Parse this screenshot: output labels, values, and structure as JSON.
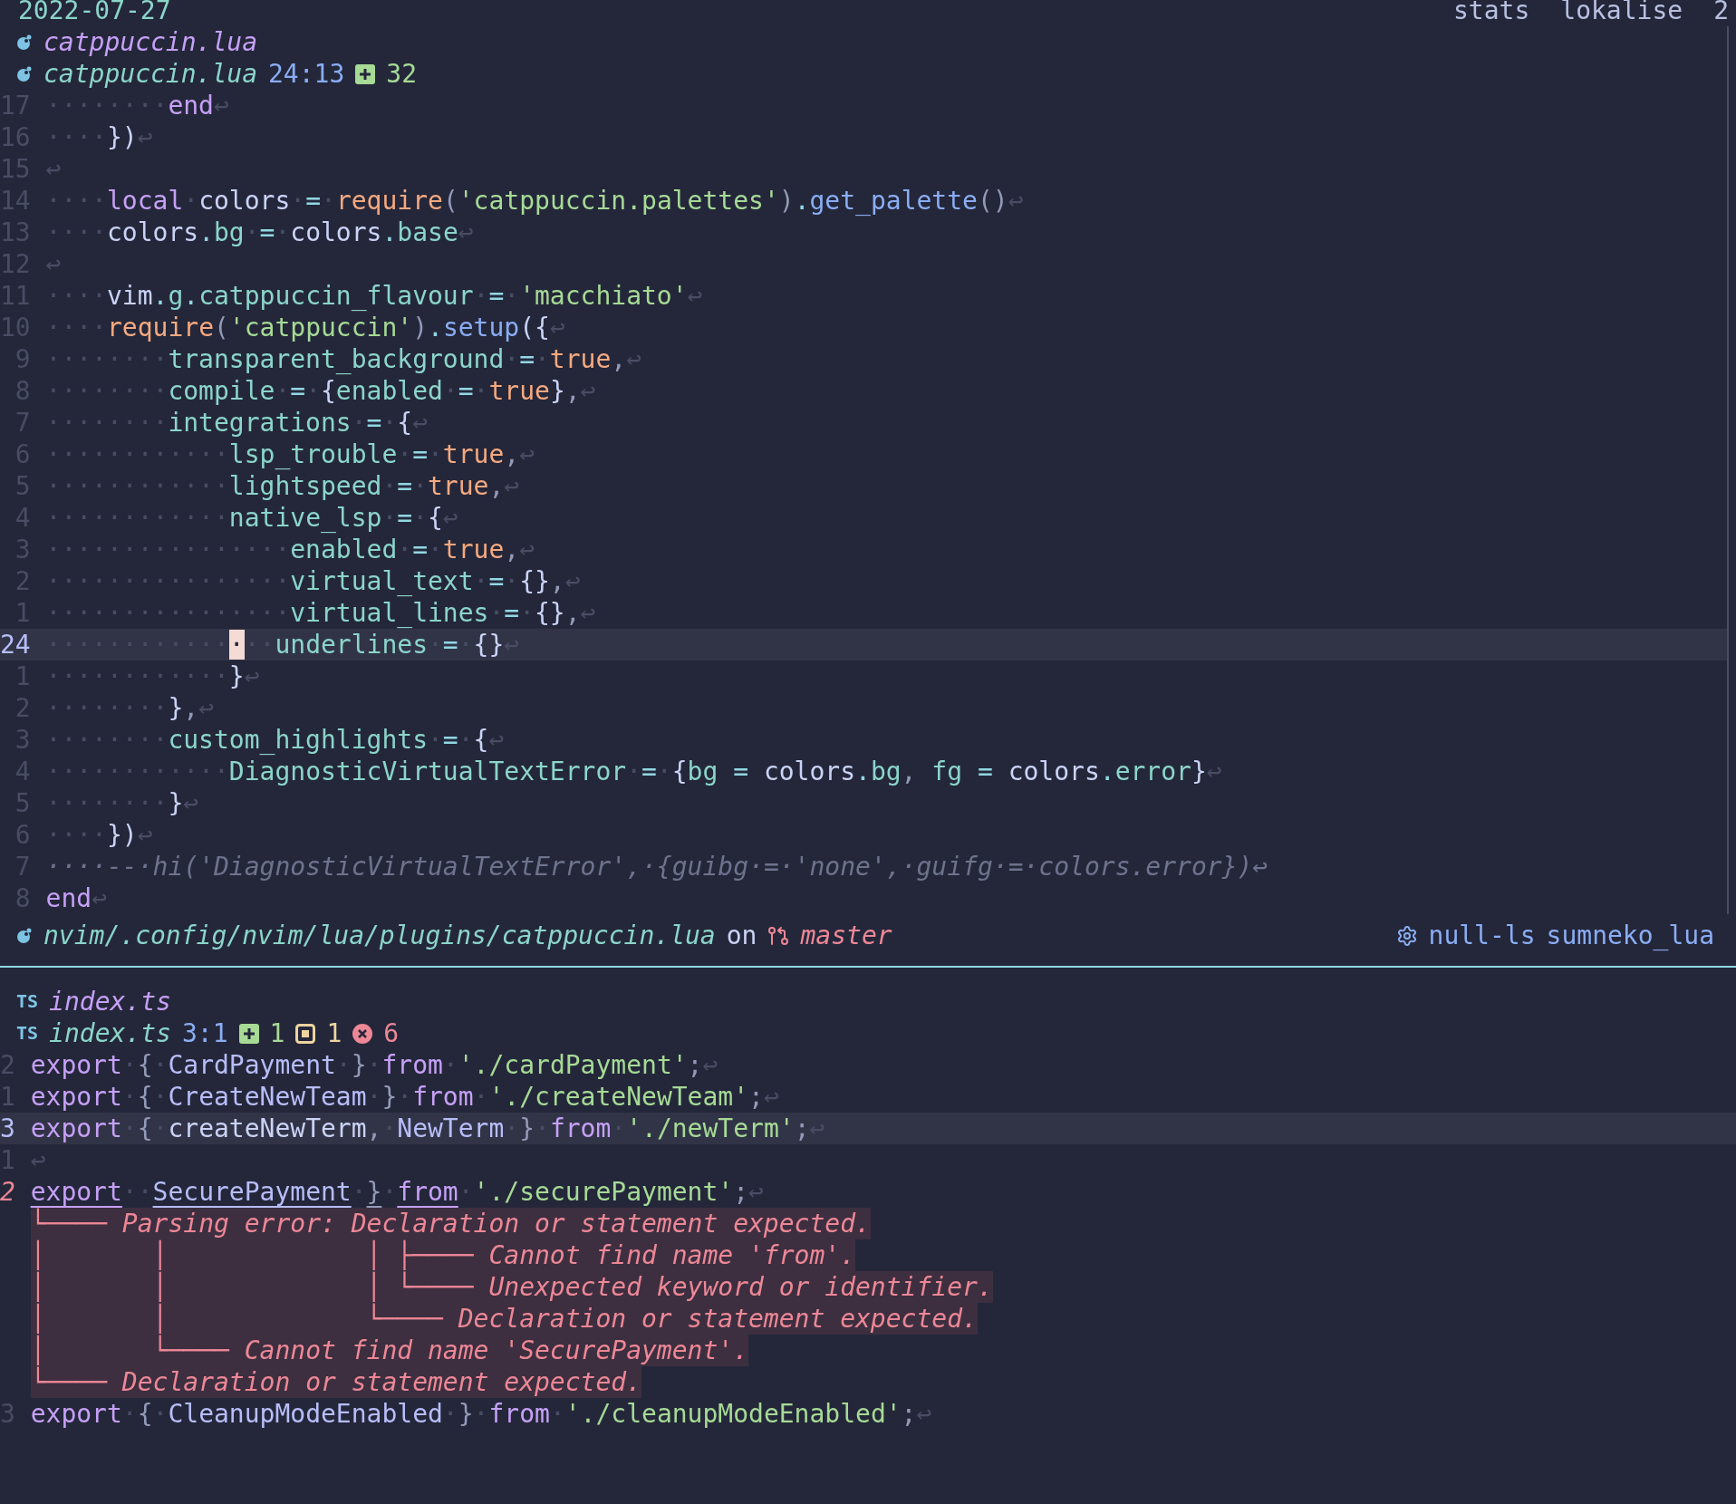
{
  "tabline": {
    "date": "2022-07-27",
    "items": [
      "stats",
      "lokalise",
      "2"
    ]
  },
  "top_pane": {
    "winbar": {
      "title": "catppuccin.lua",
      "file": "catppuccin.lua",
      "position": "24:13",
      "added": "32"
    },
    "lines": [
      {
        "number": "17",
        "current": false,
        "error": false,
        "tokens": [
          {
            "kind": "keyword",
            "text": "········end↩"
          }
        ]
      },
      {
        "number": "16",
        "current": false,
        "error": false,
        "tokens": [
          {
            "kind": "brace",
            "text": "····})↩"
          }
        ]
      },
      {
        "number": "15",
        "current": false,
        "error": false,
        "tokens": [
          {
            "kind": "space",
            "text": "↩"
          }
        ]
      },
      {
        "number": "14",
        "current": false,
        "error": false,
        "tokens": [
          {
            "kind": "keyword",
            "text": "····local"
          },
          {
            "kind": "variable",
            "text": "·colors"
          },
          {
            "kind": "operator",
            "text": "·=·"
          },
          {
            "kind": "literal",
            "text": "require"
          },
          {
            "kind": "punct",
            "text": "("
          },
          {
            "kind": "string",
            "text": "'catppuccin.palettes'"
          },
          {
            "kind": "punct",
            "text": ")"
          },
          {
            "kind": "operator",
            "text": "."
          },
          {
            "kind": "function",
            "text": "get_palette"
          },
          {
            "kind": "punct",
            "text": "()↩"
          }
        ]
      },
      {
        "number": "13",
        "current": false,
        "error": false,
        "tokens": [
          {
            "kind": "variable",
            "text": "····colors"
          },
          {
            "kind": "operator",
            "text": "."
          },
          {
            "kind": "field",
            "text": "bg"
          },
          {
            "kind": "operator",
            "text": "·=·"
          },
          {
            "kind": "variable",
            "text": "colors"
          },
          {
            "kind": "operator",
            "text": "."
          },
          {
            "kind": "field",
            "text": "base↩"
          }
        ]
      },
      {
        "number": "12",
        "current": false,
        "error": false,
        "tokens": [
          {
            "kind": "space",
            "text": "↩"
          }
        ]
      },
      {
        "number": "11",
        "current": false,
        "error": false,
        "tokens": [
          {
            "kind": "variable",
            "text": "····vim"
          },
          {
            "kind": "operator",
            "text": "."
          },
          {
            "kind": "field",
            "text": "g"
          },
          {
            "kind": "operator",
            "text": "."
          },
          {
            "kind": "field",
            "text": "catppuccin_flavour"
          },
          {
            "kind": "operator",
            "text": "·=·"
          },
          {
            "kind": "string",
            "text": "'macchiato'↩"
          }
        ]
      },
      {
        "number": "10",
        "current": false,
        "error": false,
        "tokens": [
          {
            "kind": "literal",
            "text": "····require"
          },
          {
            "kind": "punct",
            "text": "("
          },
          {
            "kind": "string",
            "text": "'catppuccin'"
          },
          {
            "kind": "punct",
            "text": ")"
          },
          {
            "kind": "operator",
            "text": "."
          },
          {
            "kind": "function",
            "text": "setup"
          },
          {
            "kind": "brace",
            "text": "({↩"
          }
        ]
      },
      {
        "number": "9",
        "current": false,
        "error": false,
        "tokens": [
          {
            "kind": "field",
            "text": "········transparent_background"
          },
          {
            "kind": "operator",
            "text": "·=·"
          },
          {
            "kind": "literal",
            "text": "true"
          },
          {
            "kind": "punct",
            "text": ",↩"
          }
        ]
      },
      {
        "number": "8",
        "current": false,
        "error": false,
        "tokens": [
          {
            "kind": "field",
            "text": "········compile"
          },
          {
            "kind": "operator",
            "text": "·=·"
          },
          {
            "kind": "brace",
            "text": "{"
          },
          {
            "kind": "field",
            "text": "enabled"
          },
          {
            "kind": "operator",
            "text": "·=·"
          },
          {
            "kind": "literal",
            "text": "true"
          },
          {
            "kind": "brace",
            "text": "}"
          },
          {
            "kind": "punct",
            "text": ",↩"
          }
        ]
      },
      {
        "number": "7",
        "current": false,
        "error": false,
        "tokens": [
          {
            "kind": "field",
            "text": "········integrations"
          },
          {
            "kind": "operator",
            "text": "·=·"
          },
          {
            "kind": "brace",
            "text": "{↩"
          }
        ]
      },
      {
        "number": "6",
        "current": false,
        "error": false,
        "tokens": [
          {
            "kind": "field",
            "text": "············lsp_trouble"
          },
          {
            "kind": "operator",
            "text": "·=·"
          },
          {
            "kind": "literal",
            "text": "true"
          },
          {
            "kind": "punct",
            "text": ",↩"
          }
        ]
      },
      {
        "number": "5",
        "current": false,
        "error": false,
        "tokens": [
          {
            "kind": "field",
            "text": "············lightspeed"
          },
          {
            "kind": "operator",
            "text": "·=·"
          },
          {
            "kind": "literal",
            "text": "true"
          },
          {
            "kind": "punct",
            "text": ",↩"
          }
        ]
      },
      {
        "number": "4",
        "current": false,
        "error": false,
        "tokens": [
          {
            "kind": "field",
            "text": "············native_lsp"
          },
          {
            "kind": "operator",
            "text": "·=·"
          },
          {
            "kind": "brace",
            "text": "{↩"
          }
        ]
      },
      {
        "number": "3",
        "current": false,
        "error": false,
        "tokens": [
          {
            "kind": "field",
            "text": "················enabled"
          },
          {
            "kind": "operator",
            "text": "·=·"
          },
          {
            "kind": "literal",
            "text": "true"
          },
          {
            "kind": "punct",
            "text": ",↩"
          }
        ]
      },
      {
        "number": "2",
        "current": false,
        "error": false,
        "tokens": [
          {
            "kind": "field",
            "text": "················virtual_text"
          },
          {
            "kind": "operator",
            "text": "·=·"
          },
          {
            "kind": "brace",
            "text": "{}"
          },
          {
            "kind": "punct",
            "text": ",↩"
          }
        ]
      },
      {
        "number": "1",
        "current": false,
        "error": false,
        "tokens": [
          {
            "kind": "field",
            "text": "················virtual_lines"
          },
          {
            "kind": "operator",
            "text": "·=·"
          },
          {
            "kind": "brace",
            "text": "{}"
          },
          {
            "kind": "punct",
            "text": ",↩"
          }
        ]
      },
      {
        "number": "24",
        "current": true,
        "error": false,
        "tokens": [
          {
            "kind": "space",
            "text": "············"
          },
          {
            "kind": "cursor",
            "text": "·"
          },
          {
            "kind": "field",
            "text": "··underlines"
          },
          {
            "kind": "operator",
            "text": "·=·"
          },
          {
            "kind": "brace",
            "text": "{}↩"
          }
        ]
      },
      {
        "number": "1",
        "current": false,
        "error": false,
        "tokens": [
          {
            "kind": "brace",
            "text": "············}↩"
          }
        ]
      },
      {
        "number": "2",
        "current": false,
        "error": false,
        "tokens": [
          {
            "kind": "brace",
            "text": "········}"
          },
          {
            "kind": "punct",
            "text": ",↩"
          }
        ]
      },
      {
        "number": "3",
        "current": false,
        "error": false,
        "tokens": [
          {
            "kind": "field",
            "text": "········custom_highlights"
          },
          {
            "kind": "operator",
            "text": "·=·"
          },
          {
            "kind": "brace",
            "text": "{↩"
          }
        ]
      },
      {
        "number": "4",
        "current": false,
        "error": false,
        "tokens": [
          {
            "kind": "field",
            "text": "············DiagnosticVirtualTextError"
          },
          {
            "kind": "operator",
            "text": "·=·"
          },
          {
            "kind": "brace",
            "text": "{"
          },
          {
            "kind": "field",
            "text": "bg"
          },
          {
            "kind": "operator",
            "text": " = "
          },
          {
            "kind": "variable",
            "text": "colors"
          },
          {
            "kind": "operator",
            "text": "."
          },
          {
            "kind": "field",
            "text": "bg"
          },
          {
            "kind": "punct",
            "text": ", "
          },
          {
            "kind": "field",
            "text": "fg"
          },
          {
            "kind": "operator",
            "text": " = "
          },
          {
            "kind": "variable",
            "text": "colors"
          },
          {
            "kind": "operator",
            "text": "."
          },
          {
            "kind": "field",
            "text": "error"
          },
          {
            "kind": "brace",
            "text": "}↩"
          }
        ]
      },
      {
        "number": "5",
        "current": false,
        "error": false,
        "tokens": [
          {
            "kind": "brace",
            "text": "········}↩"
          }
        ]
      },
      {
        "number": "6",
        "current": false,
        "error": false,
        "tokens": [
          {
            "kind": "brace",
            "text": "····})↩"
          }
        ]
      },
      {
        "number": "7",
        "current": false,
        "error": false,
        "tokens": [
          {
            "kind": "comment",
            "text": "····--·hi('DiagnosticVirtualTextError',·{guibg·=·'none',·guifg·=·colors.error})↩"
          }
        ]
      },
      {
        "number": "8",
        "current": false,
        "error": false,
        "tokens": [
          {
            "kind": "keyword",
            "text": "end↩"
          }
        ]
      }
    ],
    "statusline": {
      "path": "nvim/.config/nvim/lua/plugins/catppuccin.lua",
      "on": "on",
      "branch": "master",
      "clients": [
        "null-ls",
        "sumneko_lua"
      ]
    }
  },
  "bottom_pane": {
    "winbar": {
      "badge": "TS",
      "title": "index.ts",
      "badge_2": "TS",
      "file": "index.ts",
      "position": "3:1",
      "added": "1",
      "changed": "1",
      "errors": "6"
    },
    "lines": [
      {
        "number": "2",
        "current": false,
        "error": false,
        "tokens": [
          {
            "kind": "keyword",
            "text": "export"
          },
          {
            "kind": "punct",
            "text": "·{·"
          },
          {
            "kind": "type",
            "text": "CardPayment"
          },
          {
            "kind": "punct",
            "text": "·}·"
          },
          {
            "kind": "keyword",
            "text": "from"
          },
          {
            "kind": "string",
            "text": "·'./cardPayment'"
          },
          {
            "kind": "punct",
            "text": ";↩"
          }
        ]
      },
      {
        "number": "1",
        "current": false,
        "error": false,
        "tokens": [
          {
            "kind": "keyword",
            "text": "export"
          },
          {
            "kind": "punct",
            "text": "·{·"
          },
          {
            "kind": "type",
            "text": "CreateNewTeam"
          },
          {
            "kind": "punct",
            "text": "·}·"
          },
          {
            "kind": "keyword",
            "text": "from"
          },
          {
            "kind": "string",
            "text": "·'./createNewTeam'"
          },
          {
            "kind": "punct",
            "text": ";↩"
          }
        ]
      },
      {
        "number": "3",
        "current": true,
        "error": false,
        "tokens": [
          {
            "kind": "keyword",
            "text": "export"
          },
          {
            "kind": "punct",
            "text": "·{·"
          },
          {
            "kind": "variable",
            "text": "createNewTerm"
          },
          {
            "kind": "punct",
            "text": ",·"
          },
          {
            "kind": "type",
            "text": "NewTerm"
          },
          {
            "kind": "punct",
            "text": "·}·"
          },
          {
            "kind": "keyword",
            "text": "from"
          },
          {
            "kind": "string",
            "text": "·'./newTerm'"
          },
          {
            "kind": "punct",
            "text": ";↩"
          }
        ]
      },
      {
        "number": "1",
        "current": false,
        "error": false,
        "tokens": [
          {
            "kind": "space",
            "text": "↩"
          }
        ]
      },
      {
        "number": "2",
        "current": false,
        "error": true,
        "tokens": [
          {
            "kind": "keyword",
            "text": "export",
            "underlined": true
          },
          {
            "kind": "space",
            "text": "··",
            "underlined": false
          },
          {
            "kind": "type",
            "text": "SecurePayment",
            "underlined": true
          },
          {
            "kind": "space",
            "text": "·",
            "underlined": false
          },
          {
            "kind": "punct",
            "text": "}",
            "underlined": true
          },
          {
            "kind": "space",
            "text": "·",
            "underlined": false
          },
          {
            "kind": "keyword",
            "text": "from",
            "underlined": true
          },
          {
            "kind": "string",
            "text": "·'./securePayment'",
            "underlined": false
          },
          {
            "kind": "punct",
            "text": ";↩",
            "underlined": false
          }
        ],
        "diagnostics": [
          {
            "prefix": "└──── ",
            "message": "Parsing error: Declaration or statement expected."
          },
          {
            "prefix": "│       │             │ ├──── ",
            "message": "Cannot find name 'from'."
          },
          {
            "prefix": "│       │             │ └──── ",
            "message": "Unexpected keyword or identifier."
          },
          {
            "prefix": "│       │             └──── ",
            "message": "Declaration or statement expected."
          },
          {
            "prefix": "│       └──── ",
            "message": "Cannot find name 'SecurePayment'."
          },
          {
            "prefix": "└──── ",
            "message": "Declaration or statement expected."
          }
        ]
      },
      {
        "number": "3",
        "current": false,
        "error": false,
        "tokens": [
          {
            "kind": "keyword",
            "text": "export"
          },
          {
            "kind": "punct",
            "text": "·{·"
          },
          {
            "kind": "type",
            "text": "CleanupModeEnabled"
          },
          {
            "kind": "punct",
            "text": "·}·"
          },
          {
            "kind": "keyword",
            "text": "from"
          },
          {
            "kind": "string",
            "text": "·'./cleanupModeEnabled'"
          },
          {
            "kind": "punct",
            "text": ";↩"
          }
        ]
      }
    ]
  }
}
